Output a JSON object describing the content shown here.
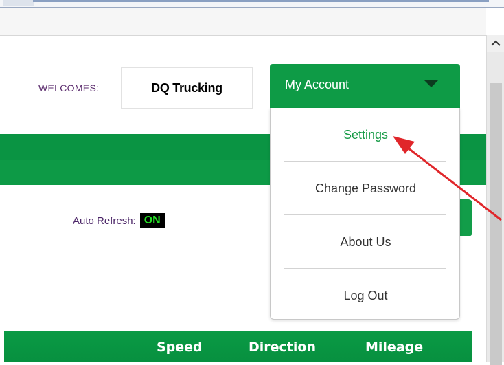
{
  "header": {
    "welcome_label": "WELCOMES:",
    "company_name": "DQ Trucking"
  },
  "account_menu": {
    "button_label": "My Account",
    "items": [
      {
        "label": "Settings"
      },
      {
        "label": "Change Password"
      },
      {
        "label": "About Us"
      },
      {
        "label": "Log Out"
      }
    ]
  },
  "status": {
    "auto_refresh_label": "Auto Refresh:",
    "auto_refresh_value": "ON"
  },
  "table": {
    "columns": [
      "Speed",
      "Direction",
      "Mileage"
    ]
  },
  "icons": {
    "dropdown_caret": "caret-down-icon",
    "scroll_up": "chevron-up-icon",
    "annotation": "red-arrow-icon"
  },
  "colors": {
    "brand_green": "#0e9b46",
    "settings_text": "#159a45",
    "on_badge_text": "#25e025",
    "label_purple": "#5a2a6c",
    "annotation_red": "#e0262a"
  }
}
